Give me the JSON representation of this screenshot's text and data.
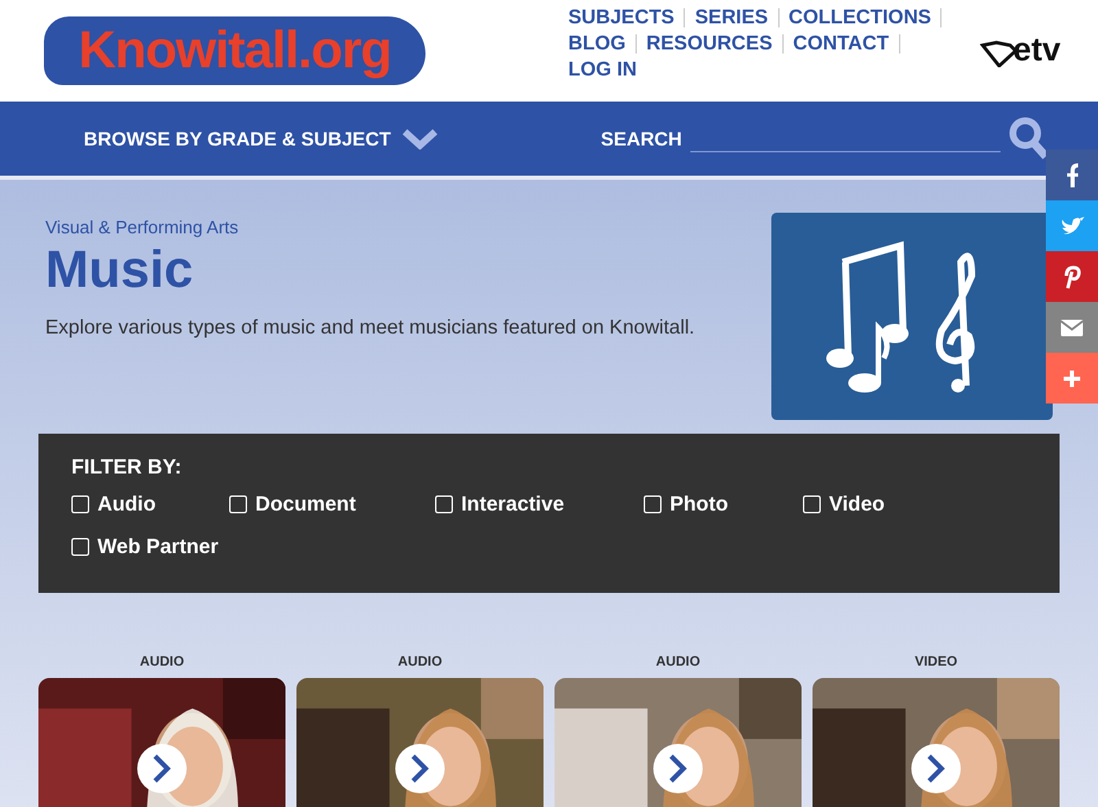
{
  "logo": {
    "text": "Knowitall.org"
  },
  "top_links": [
    {
      "label": "SUBJECTS"
    },
    {
      "label": "SERIES"
    },
    {
      "label": "COLLECTIONS"
    },
    {
      "label": "BLOG"
    },
    {
      "label": "RESOURCES"
    },
    {
      "label": "CONTACT"
    },
    {
      "label": "LOG IN"
    }
  ],
  "partner_logo": {
    "text": "etv"
  },
  "nav": {
    "browse": "BROWSE BY GRADE & SUBJECT",
    "search_label": "SEARCH"
  },
  "share": [
    {
      "kind": "facebook",
      "color": "#3b5998"
    },
    {
      "kind": "twitter",
      "color": "#1da1f2"
    },
    {
      "kind": "pinterest",
      "color": "#cb2027"
    },
    {
      "kind": "email",
      "color": "#848484"
    },
    {
      "kind": "more",
      "color": "#ff6550"
    }
  ],
  "hero": {
    "category": "Visual & Performing Arts",
    "title": "Music",
    "description": "Explore various types of music and meet musicians featured on Knowitall."
  },
  "filter": {
    "title": "FILTER BY:",
    "options": [
      {
        "label": "Audio",
        "checked": false
      },
      {
        "label": "Document",
        "checked": false
      },
      {
        "label": "Interactive",
        "checked": false
      },
      {
        "label": "Photo",
        "checked": false
      },
      {
        "label": "Video",
        "checked": false
      },
      {
        "label": "Web Partner",
        "checked": false
      }
    ]
  },
  "cards": [
    {
      "type": "AUDIO",
      "kind": "picture"
    },
    {
      "type": "AUDIO",
      "kind": "picture"
    },
    {
      "type": "AUDIO",
      "kind": "picture"
    },
    {
      "type": "VIDEO",
      "kind": "picture"
    }
  ]
}
